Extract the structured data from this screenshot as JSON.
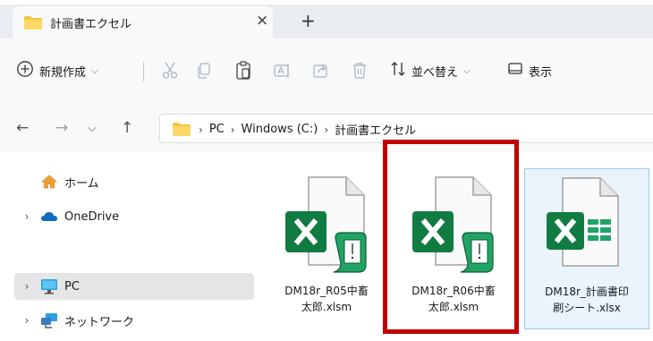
{
  "tab": {
    "title": "計画書エクセル",
    "close": "×",
    "new_tab": "+"
  },
  "toolbar": {
    "new_label": "新規作成",
    "sort_label": "並べ替え",
    "view_label": "表示"
  },
  "address": {
    "crumbs": [
      "PC",
      "Windows (C:)",
      "計画書エクセル"
    ]
  },
  "sidebar": {
    "items": [
      {
        "label": "ホーム"
      },
      {
        "label": "OneDrive"
      },
      {
        "label": "PC"
      },
      {
        "label": "ネットワーク"
      }
    ]
  },
  "files": [
    {
      "name": "DM18r_R05中畜\n太郎.xlsm",
      "type": "xlsm"
    },
    {
      "name": "DM18r_R06中畜\n太郎.xlsm",
      "type": "xlsm"
    },
    {
      "name": "DM18r_計画書印\n刷シート.xlsx",
      "type": "xlsx"
    }
  ],
  "colors": {
    "excel_green": "#107c41",
    "excel_dark": "#0b5e30",
    "folder_yellow": "#f4c542",
    "highlight_red": "#c00000",
    "onedrive_blue": "#0f6cbd"
  }
}
